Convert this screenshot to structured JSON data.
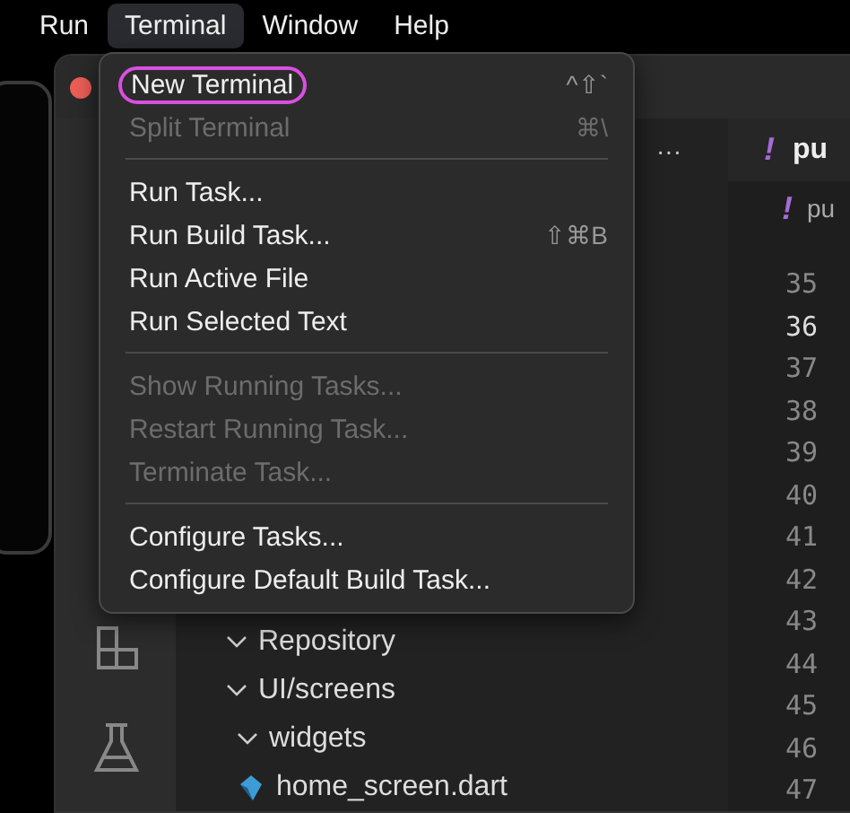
{
  "menu_bar": [
    {
      "label": "Run",
      "selected": false
    },
    {
      "label": "Terminal",
      "selected": true
    },
    {
      "label": "Window",
      "selected": false
    },
    {
      "label": "Help",
      "selected": false
    }
  ],
  "menu": [
    {
      "kind": "item",
      "label": "New Terminal",
      "shortcut": "^⇧`",
      "disabled": false,
      "highlighted": true
    },
    {
      "kind": "item",
      "label": "Split Terminal",
      "shortcut": "⌘\\",
      "disabled": true,
      "highlighted": false
    },
    {
      "kind": "separator"
    },
    {
      "kind": "item",
      "label": "Run Task...",
      "disabled": false,
      "highlighted": false
    },
    {
      "kind": "item",
      "label": "Run Build Task...",
      "shortcut": "⇧⌘B",
      "disabled": false,
      "highlighted": false
    },
    {
      "kind": "item",
      "label": "Run Active File",
      "disabled": false,
      "highlighted": false
    },
    {
      "kind": "item",
      "label": "Run Selected Text",
      "disabled": false,
      "highlighted": false
    },
    {
      "kind": "separator"
    },
    {
      "kind": "item",
      "label": "Show Running Tasks...",
      "disabled": true,
      "highlighted": false
    },
    {
      "kind": "item",
      "label": "Restart Running Task...",
      "disabled": true,
      "highlighted": false
    },
    {
      "kind": "item",
      "label": "Terminate Task...",
      "disabled": true,
      "highlighted": false
    },
    {
      "kind": "separator"
    },
    {
      "kind": "item",
      "label": "Configure Tasks...",
      "disabled": false,
      "highlighted": false
    },
    {
      "kind": "item",
      "label": "Configure Default Build Task...",
      "disabled": false,
      "highlighted": false
    }
  ],
  "sidebar": {
    "more": "···",
    "tree": [
      {
        "label": "Repository",
        "kind": "folder",
        "expanded": true
      },
      {
        "label": "UI/screens",
        "kind": "folder",
        "expanded": true,
        "children": [
          {
            "label": "widgets",
            "kind": "folder",
            "expanded": true
          },
          {
            "label": "home_screen.dart",
            "kind": "file"
          }
        ]
      }
    ]
  },
  "editor": {
    "tab": {
      "icon": "!",
      "label": "pu"
    },
    "breadcrumb": {
      "icon": "!",
      "label": "pu"
    },
    "line_numbers": [
      {
        "number": "35",
        "current": false
      },
      {
        "number": "36",
        "current": true
      },
      {
        "number": "37",
        "current": false
      },
      {
        "number": "38",
        "current": false
      },
      {
        "number": "39",
        "current": false
      },
      {
        "number": "40",
        "current": false
      },
      {
        "number": "41",
        "current": false
      },
      {
        "number": "42",
        "current": false
      },
      {
        "number": "43",
        "current": false
      },
      {
        "number": "44",
        "current": false
      },
      {
        "number": "45",
        "current": false
      },
      {
        "number": "46",
        "current": false
      },
      {
        "number": "47",
        "current": false
      }
    ]
  }
}
